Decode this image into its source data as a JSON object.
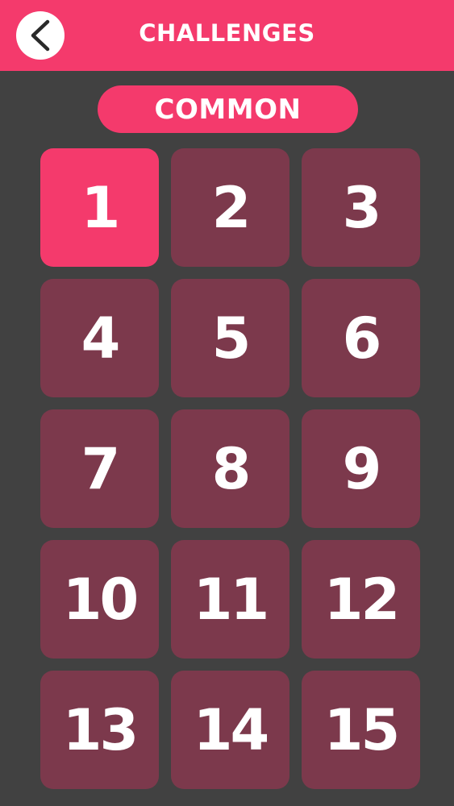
{
  "header": {
    "title": "CHALLENGES",
    "back_icon": "chevron-left-icon"
  },
  "category": {
    "label": "COMMON"
  },
  "levels": [
    {
      "label": "1",
      "state": "selected"
    },
    {
      "label": "2",
      "state": "default"
    },
    {
      "label": "3",
      "state": "default"
    },
    {
      "label": "4",
      "state": "default"
    },
    {
      "label": "5",
      "state": "default"
    },
    {
      "label": "6",
      "state": "default"
    },
    {
      "label": "7",
      "state": "default"
    },
    {
      "label": "8",
      "state": "default"
    },
    {
      "label": "9",
      "state": "default"
    },
    {
      "label": "10",
      "state": "default"
    },
    {
      "label": "11",
      "state": "default"
    },
    {
      "label": "12",
      "state": "default"
    },
    {
      "label": "13",
      "state": "default"
    },
    {
      "label": "14",
      "state": "default"
    },
    {
      "label": "15",
      "state": "default"
    }
  ],
  "colors": {
    "accent": "#f43a6c",
    "tile": "#7c394c",
    "background": "#414141",
    "text": "#ffffff"
  }
}
